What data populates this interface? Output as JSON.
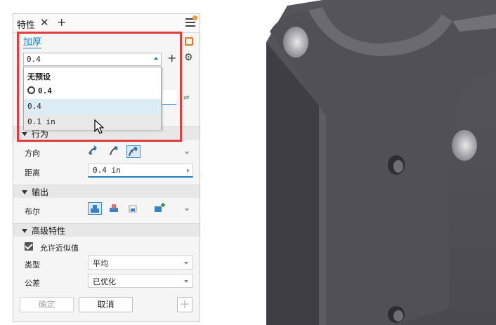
{
  "panel": {
    "tab_title": "特性",
    "tab_close": "✕",
    "tab_add": "+"
  },
  "presets": {
    "title": "加厚",
    "current_value": "0.4",
    "add_label": "+",
    "dropdown": [
      {
        "label": "无预设",
        "style": "bold"
      },
      {
        "label": "0.4",
        "style": "bold",
        "icon": "clock-icon"
      },
      {
        "label": "0.4",
        "style": "selected"
      },
      {
        "label": "0.1 in",
        "style": "hover"
      }
    ]
  },
  "behavior": {
    "header": "行为",
    "direction_label": "方向",
    "distance_label": "距离",
    "distance_value": "0.4 in"
  },
  "output": {
    "header": "输出",
    "boolean_label": "布尔"
  },
  "advanced": {
    "header": "高级特性",
    "allow_approx_label": "允许近似值",
    "type_label": "类型",
    "type_value": "平均",
    "tolerance_label": "公差",
    "tolerance_value": "已优化"
  },
  "footer": {
    "ok_label": "确定",
    "cancel_label": "取消",
    "plus_label": "+"
  },
  "colors": {
    "accent": "#1d7ec2",
    "highlight": "#e33a3a",
    "menu_dot": "#f39c34",
    "model_dark": "#3a3a3e",
    "model_face": "#5a5a60"
  }
}
